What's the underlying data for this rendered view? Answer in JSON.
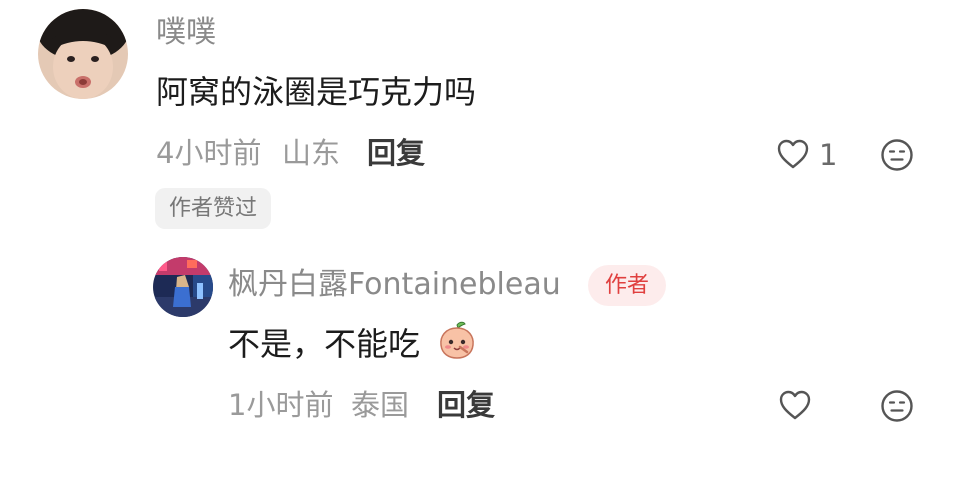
{
  "comment": {
    "username": "噗噗",
    "text": "阿窝的泳圈是巧克力吗",
    "time": "4小时前",
    "location": "山东",
    "reply_label": "回复",
    "like_count": "1",
    "liked_by_author_label": "作者赞过"
  },
  "reply": {
    "username": "枫丹白露Fontainebleau",
    "author_badge": "作者",
    "text": "不是，不能吃",
    "time": "1小时前",
    "location": "泰国",
    "reply_label": "回复"
  },
  "icons": {
    "like": "heart-outline-icon",
    "dislike": "neutral-face-icon",
    "emoji": "peach-sticker-icon"
  },
  "colors": {
    "author_badge_text": "#e0403f",
    "author_badge_bg": "#fdecec"
  }
}
